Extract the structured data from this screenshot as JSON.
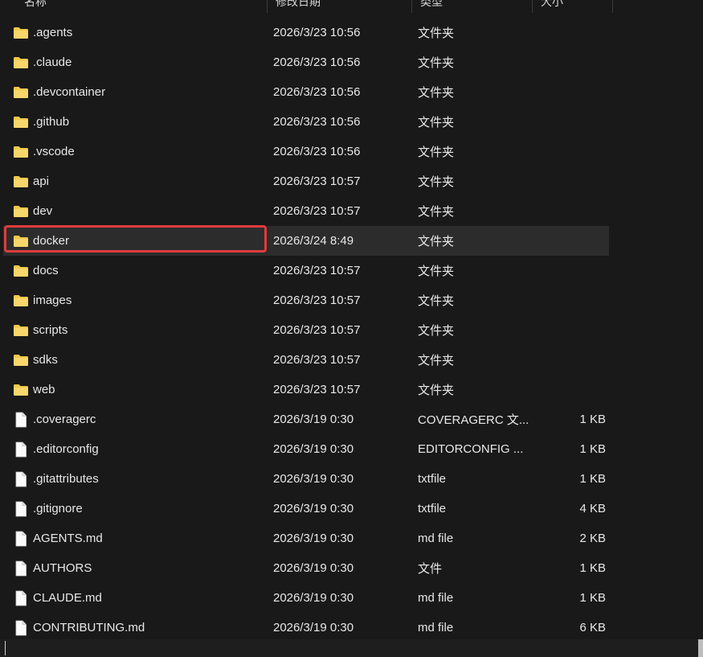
{
  "columns": {
    "name": "名称",
    "date": "修改日期",
    "type": "类型",
    "size": "大小"
  },
  "rows": [
    {
      "name": ".agents",
      "date": "2026/3/23 10:56",
      "type": "文件夹",
      "size": "",
      "icon": "folder-icon"
    },
    {
      "name": ".claude",
      "date": "2026/3/23 10:56",
      "type": "文件夹",
      "size": "",
      "icon": "folder-icon"
    },
    {
      "name": ".devcontainer",
      "date": "2026/3/23 10:56",
      "type": "文件夹",
      "size": "",
      "icon": "folder-icon"
    },
    {
      "name": ".github",
      "date": "2026/3/23 10:56",
      "type": "文件夹",
      "size": "",
      "icon": "folder-icon"
    },
    {
      "name": ".vscode",
      "date": "2026/3/23 10:56",
      "type": "文件夹",
      "size": "",
      "icon": "folder-icon"
    },
    {
      "name": "api",
      "date": "2026/3/23 10:57",
      "type": "文件夹",
      "size": "",
      "icon": "folder-icon"
    },
    {
      "name": "dev",
      "date": "2026/3/23 10:57",
      "type": "文件夹",
      "size": "",
      "icon": "folder-icon"
    },
    {
      "name": "docker",
      "date": "2026/3/24 8:49",
      "type": "文件夹",
      "size": "",
      "icon": "folder-icon",
      "hover": true
    },
    {
      "name": "docs",
      "date": "2026/3/23 10:57",
      "type": "文件夹",
      "size": "",
      "icon": "folder-icon"
    },
    {
      "name": "images",
      "date": "2026/3/23 10:57",
      "type": "文件夹",
      "size": "",
      "icon": "folder-icon"
    },
    {
      "name": "scripts",
      "date": "2026/3/23 10:57",
      "type": "文件夹",
      "size": "",
      "icon": "folder-icon"
    },
    {
      "name": "sdks",
      "date": "2026/3/23 10:57",
      "type": "文件夹",
      "size": "",
      "icon": "folder-icon"
    },
    {
      "name": "web",
      "date": "2026/3/23 10:57",
      "type": "文件夹",
      "size": "",
      "icon": "folder-icon"
    },
    {
      "name": ".coveragerc",
      "date": "2026/3/19 0:30",
      "type": "COVERAGERC 文...",
      "size": "1 KB",
      "icon": "file-icon"
    },
    {
      "name": ".editorconfig",
      "date": "2026/3/19 0:30",
      "type": "EDITORCONFIG ...",
      "size": "1 KB",
      "icon": "file-icon"
    },
    {
      "name": ".gitattributes",
      "date": "2026/3/19 0:30",
      "type": "txtfile",
      "size": "1 KB",
      "icon": "file-icon"
    },
    {
      "name": ".gitignore",
      "date": "2026/3/19 0:30",
      "type": "txtfile",
      "size": "4 KB",
      "icon": "file-icon"
    },
    {
      "name": "AGENTS.md",
      "date": "2026/3/19 0:30",
      "type": "md file",
      "size": "2 KB",
      "icon": "file-icon"
    },
    {
      "name": "AUTHORS",
      "date": "2026/3/19 0:30",
      "type": "文件",
      "size": "1 KB",
      "icon": "file-icon"
    },
    {
      "name": "CLAUDE.md",
      "date": "2026/3/19 0:30",
      "type": "md file",
      "size": "1 KB",
      "icon": "file-icon"
    },
    {
      "name": "CONTRIBUTING.md",
      "date": "2026/3/19 0:30",
      "type": "md file",
      "size": "6 KB",
      "icon": "file-icon"
    }
  ],
  "colors": {
    "background": "#191919",
    "hover_row": "#2c2c2c",
    "highlight_border": "#e03b3b",
    "folder": "#f2c94c"
  }
}
